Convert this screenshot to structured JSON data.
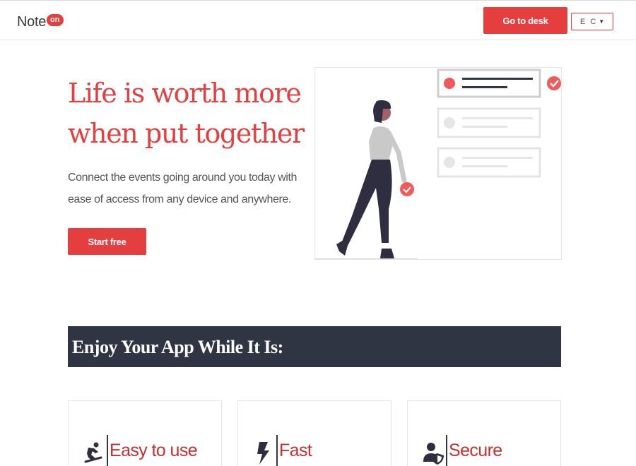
{
  "header": {
    "logo_text": "Note",
    "logo_badge": "on",
    "desk_button": "Go to desk",
    "language": "E C"
  },
  "hero": {
    "title_line1": "Life is worth more",
    "title_line2": "when put together",
    "description": "Connect the events going around you today with ease of access from any device and anywhere.",
    "cta": "Start free"
  },
  "features": {
    "heading": "Enjoy Your App While It Is:",
    "cards": [
      {
        "title": "Easy to use",
        "icon": "snowboarding-icon"
      },
      {
        "title": "Fast",
        "icon": "bolt-icon"
      },
      {
        "title": "Secure",
        "icon": "user-shield-icon"
      }
    ]
  },
  "colors": {
    "accent": "#e53e3e",
    "dark": "#2f3542",
    "card_title": "#c53030"
  }
}
